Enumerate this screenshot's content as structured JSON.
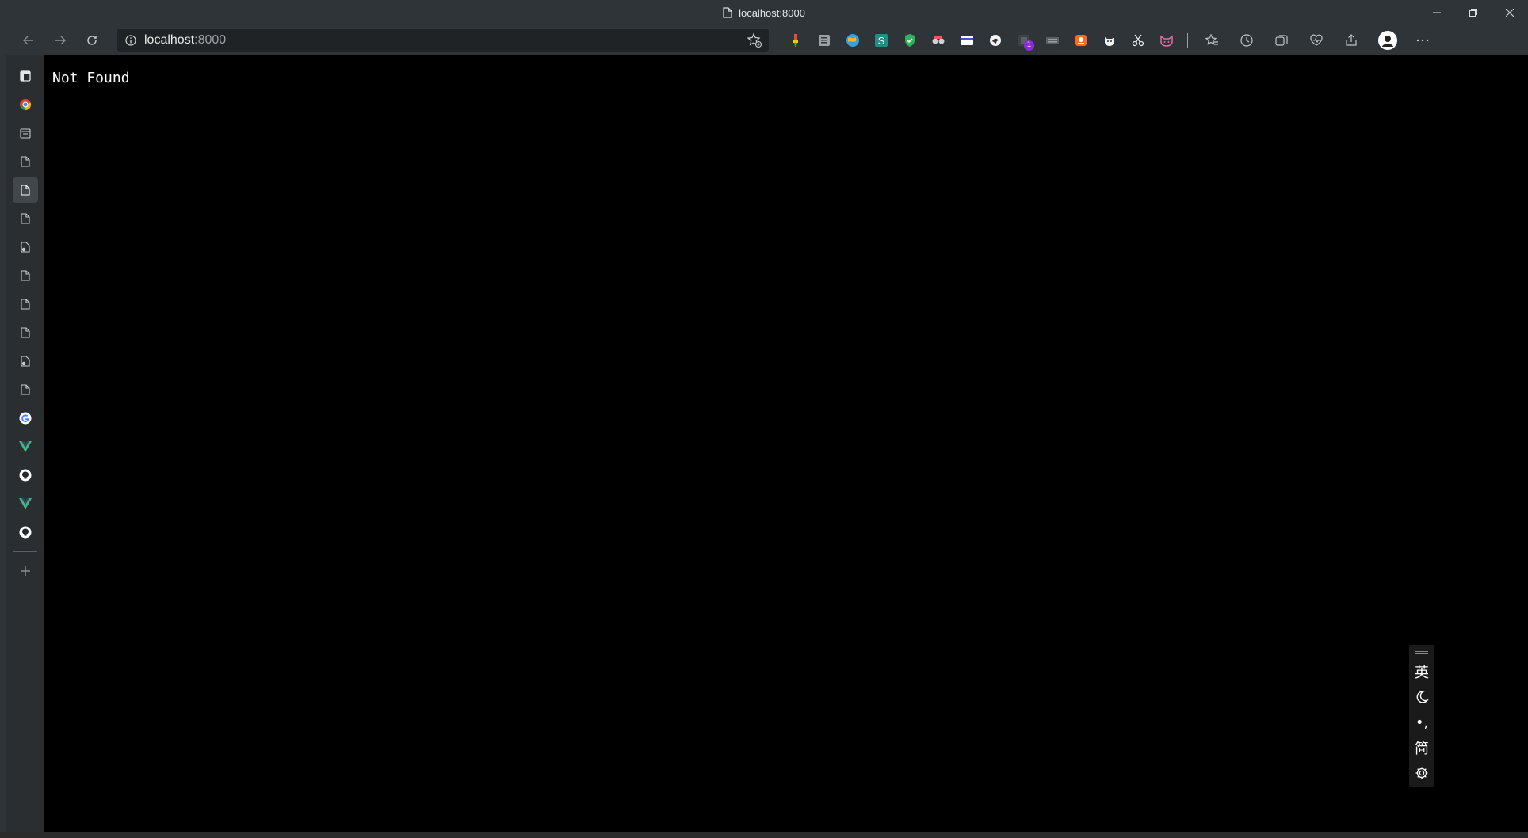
{
  "window": {
    "title": "localhost:8000"
  },
  "toolbar": {
    "url_host": "localhost",
    "url_port": ":8000",
    "extension_badge": "1"
  },
  "page": {
    "message": "Not Found"
  },
  "ime": {
    "lang": "英",
    "punct": "•,",
    "script": "简"
  },
  "icons": {
    "sidebar": [
      "doc-icon",
      "chrome-icon",
      "doc-icon",
      "doc-icon",
      "doc-icon",
      "doc-icon",
      "doc-gear-icon",
      "doc-icon",
      "doc-icon",
      "doc-icon",
      "doc-gear-icon",
      "doc-icon",
      "google-icon",
      "vue-icon",
      "github-icon",
      "vue-icon",
      "github-icon",
      "plus-icon"
    ]
  }
}
